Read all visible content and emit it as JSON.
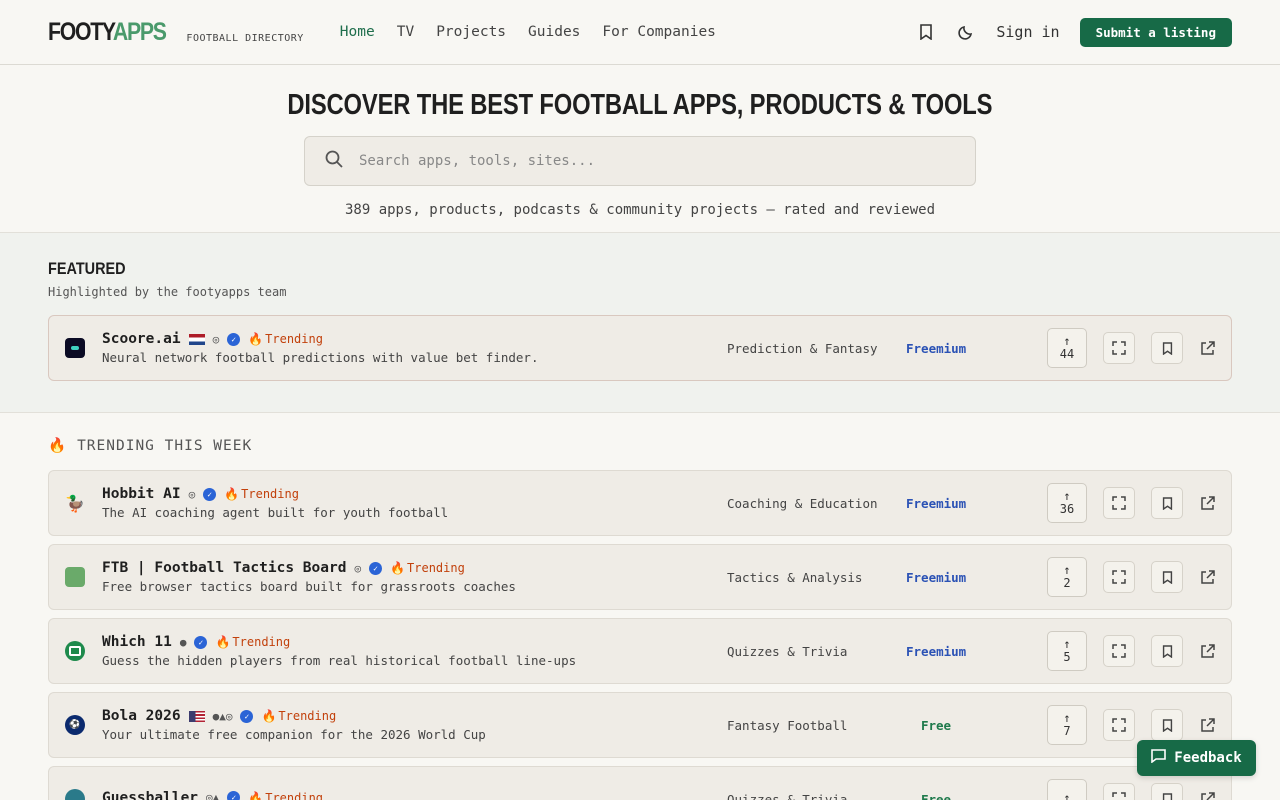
{
  "header": {
    "logo_part1": "FOOTY",
    "logo_part2": "APPS",
    "logo_sub": "FOOTBALL DIRECTORY",
    "nav": [
      "Home",
      "TV",
      "Projects",
      "Guides",
      "For Companies"
    ],
    "signin": "Sign in",
    "submit": "Submit a listing"
  },
  "hero": {
    "title": "DISCOVER THE BEST FOOTBALL APPS, PRODUCTS & TOOLS",
    "search_placeholder": "Search apps, tools, sites...",
    "stats": "389 apps, products, podcasts & community projects — rated and reviewed"
  },
  "featured": {
    "title": "FEATURED",
    "subtitle": "Highlighted by the footyapps team",
    "item": {
      "name": "Scoore.ai",
      "trend": "Trending",
      "desc": "Neural network football predictions with value bet finder.",
      "category": "Prediction & Fantasy",
      "pricing": "Freemium",
      "votes": "44"
    }
  },
  "trending": {
    "title": "TRENDING THIS WEEK",
    "items": [
      {
        "name": "Hobbit AI",
        "trend": "Trending",
        "desc": "The AI coaching agent built for youth football",
        "category": "Coaching & Education",
        "pricing": "Freemium",
        "votes": "36"
      },
      {
        "name": "FTB | Football Tactics Board",
        "trend": "Trending",
        "desc": "Free browser tactics board built for grassroots coaches",
        "category": "Tactics & Analysis",
        "pricing": "Freemium",
        "votes": "2"
      },
      {
        "name": "Which 11",
        "trend": "Trending",
        "desc": "Guess the hidden players from real historical football line-ups",
        "category": "Quizzes & Trivia",
        "pricing": "Freemium",
        "votes": "5"
      },
      {
        "name": "Bola 2026",
        "trend": "Trending",
        "desc": "Your ultimate free companion for the 2026 World Cup",
        "category": "Fantasy Football",
        "pricing": "Free",
        "votes": "7"
      },
      {
        "name": "Guessballer",
        "trend": "Trending",
        "desc": "",
        "category": "Quizzes & Trivia",
        "pricing": "Free",
        "votes": ""
      }
    ]
  },
  "feedback": "Feedback",
  "colors": {
    "accent": "#176a47",
    "trend": "#c2410c",
    "freemium": "#2b52b5",
    "free": "#1f7a4c"
  }
}
